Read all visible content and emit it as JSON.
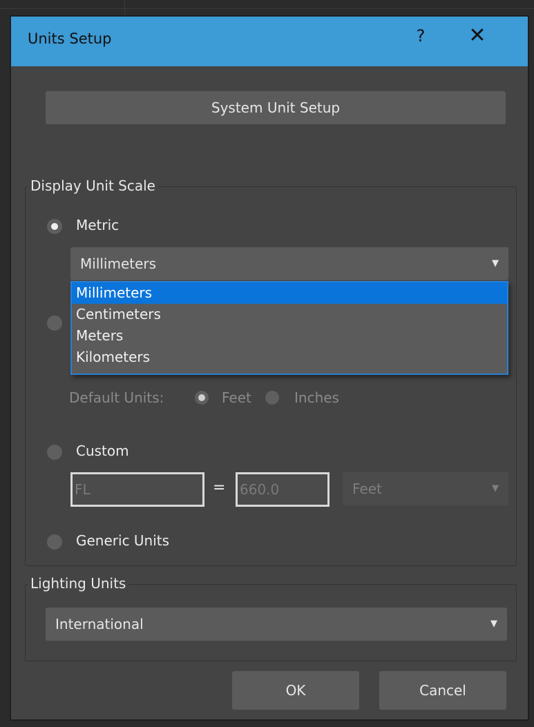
{
  "dialog": {
    "title": "Units Setup",
    "help_label": "?",
    "close_label": "✕"
  },
  "system_unit_setup": {
    "label": "System Unit Setup"
  },
  "display_unit_scale": {
    "group_label": "Display Unit Scale",
    "metric": {
      "label": "Metric",
      "selected": true,
      "select_value": "Millimeters",
      "dropdown_open": true,
      "options": [
        "Millimeters",
        "Centimeters",
        "Meters",
        "Kilometers"
      ],
      "highlighted_option": "Millimeters"
    },
    "us_standard": {
      "selected": false,
      "default_units_label": "Default Units:",
      "feet_label": "Feet",
      "inches_label": "Inches",
      "default_feet_selected": true
    },
    "custom": {
      "label": "Custom",
      "selected": false,
      "name_value": "FL",
      "equals": "=",
      "amount_value": "660.0",
      "unit_value": "Feet"
    },
    "generic": {
      "label": "Generic Units",
      "selected": false
    }
  },
  "lighting_units": {
    "group_label": "Lighting Units",
    "select_value": "International"
  },
  "buttons": {
    "ok": "OK",
    "cancel": "Cancel"
  },
  "colors": {
    "titlebar": "#3d9bd5",
    "dialog_bg": "#444444",
    "control_bg": "#5b5b5b",
    "highlight": "#0a74da"
  },
  "icons": {
    "dropdown_arrow": "▼"
  }
}
